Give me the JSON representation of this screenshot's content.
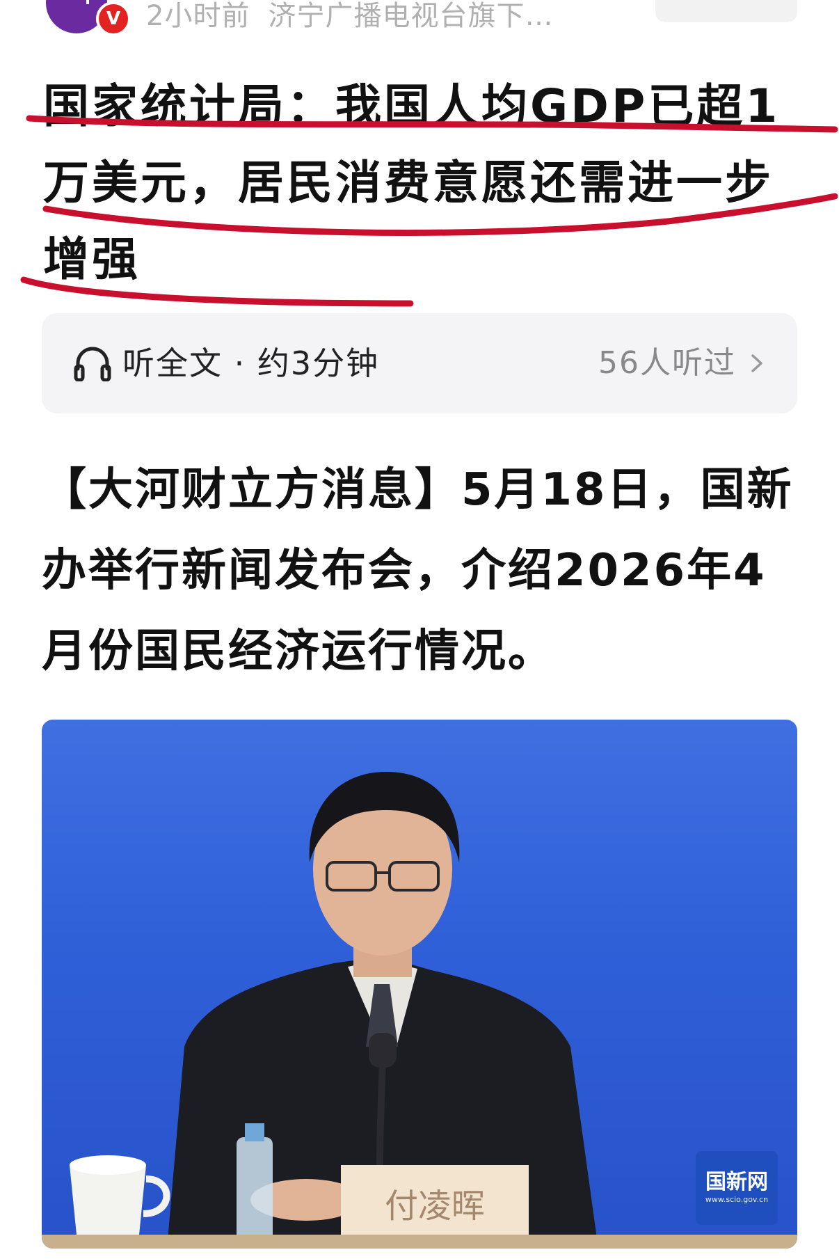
{
  "header": {
    "time_ago": "2小时前",
    "source": "济宁广播电视台旗下…",
    "verified_badge": "V"
  },
  "article": {
    "title": "国家统计局：我国人均GDP已超1万美元，居民消费意愿还需进一步增强",
    "body": "【大河财立方消息】5月18日，国新办举行新闻发布会，介绍2026年4月份国民经济运行情况。"
  },
  "audio": {
    "label": "听全文 · 约3分钟",
    "listeners": "56人听过"
  },
  "photo": {
    "nameplate": "付凌晖",
    "watermark_name": "国新网",
    "watermark_url": "www.scio.gov.cn"
  },
  "colors": {
    "annotation_red": "#c8102e",
    "photo_backdrop": "#2f5fd8",
    "verified_red": "#e32222"
  },
  "icons": [
    "headphones-icon",
    "chevron-right-icon",
    "verified-icon"
  ]
}
